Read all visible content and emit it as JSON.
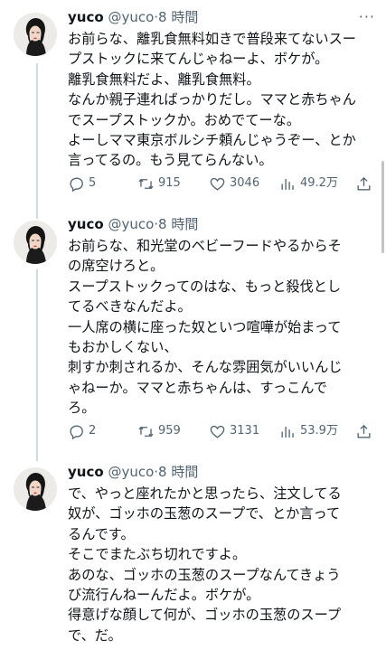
{
  "tweets": [
    {
      "name": "yuco",
      "handle": "@yuco",
      "dot": "·",
      "time": "8 時間",
      "more": "···",
      "lines": [
        "お前らな、離乳食無料如きで普段来てないスー",
        "プストックに来てんじゃねーよ、ボケが。",
        "離乳食無料だよ、離乳食無料。",
        "なんか親子連ればっかりだし。ママと赤ちゃん",
        "でスープストックか。おめでてーな。",
        "よーしママ東京ボルシチ頼んじゃうぞー、とか",
        "言ってるの。もう見てらんない。"
      ],
      "replies": "5",
      "retweets": "915",
      "likes": "3046",
      "views": "49.2万"
    },
    {
      "name": "yuco",
      "handle": "@yuco",
      "dot": "·",
      "time": "8 時間",
      "more": "",
      "lines": [
        "お前らな、和光堂のベビーフードやるからそ",
        "の席空けろと。",
        "スープストックってのはな、もっと殺伐とし",
        "てるべきなんだよ。",
        "一人席の横に座った奴といつ喧嘩が始まって",
        "もおかしくない、",
        "刺すか刺されるか、そんな雰囲気がいいんじ",
        "ゃねーか。ママと赤ちゃんは、すっこんで",
        "ろ。"
      ],
      "replies": "2",
      "retweets": "959",
      "likes": "3131",
      "views": "53.9万"
    },
    {
      "name": "yuco",
      "handle": "@yuco",
      "dot": "·",
      "time": "8 時間",
      "more": "",
      "lines": [
        "で、やっと座れたかと思ったら、注文してる",
        "奴が、ゴッホの玉葱のスープで、とか言って",
        "るんです。",
        "そこでまたぶち切れですよ。",
        "あのな、ゴッホの玉葱のスープなんてきょう",
        "び流行んねーんだよ。ボケが。",
        "得意げな顔して何が、ゴッホの玉葱のスープ",
        "で、だ。"
      ]
    }
  ]
}
